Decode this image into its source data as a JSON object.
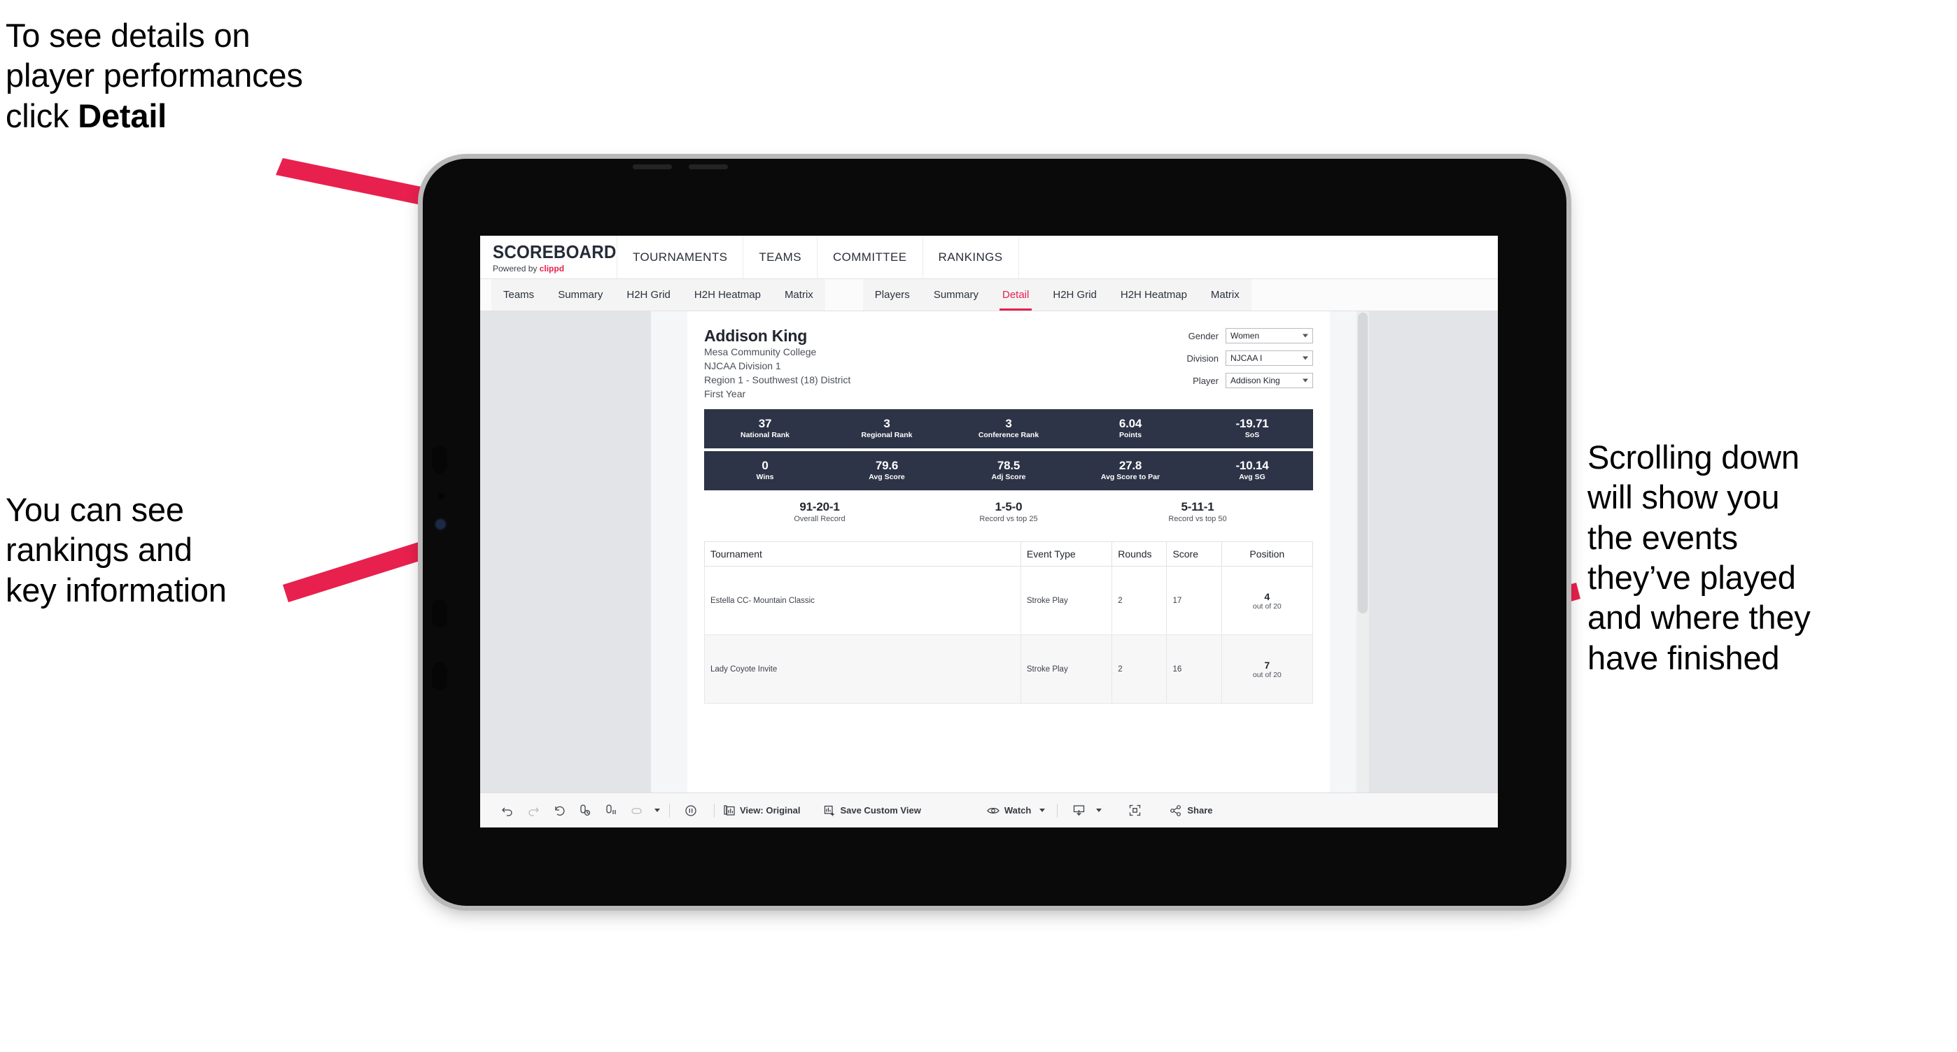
{
  "annotations": {
    "top_left": {
      "line1": "To see details on",
      "line2": "player performances",
      "line3_plain": "click ",
      "line3_bold": "Detail"
    },
    "mid_left": {
      "line1": "You can see",
      "line2": "rankings and",
      "line3": "key information"
    },
    "right": {
      "line1": "Scrolling down",
      "line2": "will show you",
      "line3": "the events",
      "line4": "they’ve played",
      "line5": "and where they",
      "line6": "have finished"
    },
    "arrow_color": "#E8204E"
  },
  "app": {
    "logo": {
      "word": "SCOREBOARD",
      "powered_prefix": "Powered by ",
      "brand": "clippd"
    },
    "top_nav": [
      {
        "label": "TOURNAMENTS"
      },
      {
        "label": "TEAMS"
      },
      {
        "label": "COMMITTEE"
      },
      {
        "label": "RANKINGS"
      }
    ],
    "sub_nav_teams": [
      {
        "label": "Teams",
        "active": false
      },
      {
        "label": "Summary",
        "active": false
      },
      {
        "label": "H2H Grid",
        "active": false
      },
      {
        "label": "H2H Heatmap",
        "active": false
      },
      {
        "label": "Matrix",
        "active": false
      }
    ],
    "sub_nav_players": [
      {
        "label": "Players",
        "active": false
      },
      {
        "label": "Summary",
        "active": false
      },
      {
        "label": "Detail",
        "active": true
      },
      {
        "label": "H2H Grid",
        "active": false
      },
      {
        "label": "H2H Heatmap",
        "active": false
      },
      {
        "label": "Matrix",
        "active": false
      }
    ],
    "accent_color": "#E8204E",
    "stat_bar_color": "#2E3447"
  },
  "player": {
    "name": "Addison King",
    "school": "Mesa Community College",
    "division": "NJCAA Division 1",
    "region": "Region 1 - Southwest (18) District",
    "year": "First Year"
  },
  "filters": [
    {
      "label": "Gender",
      "value": "Women"
    },
    {
      "label": "Division",
      "value": "NJCAA I"
    },
    {
      "label": "Player",
      "value": "Addison King"
    }
  ],
  "stats_row_1": [
    {
      "value": "37",
      "label": "National Rank"
    },
    {
      "value": "3",
      "label": "Regional Rank"
    },
    {
      "value": "3",
      "label": "Conference Rank"
    },
    {
      "value": "6.04",
      "label": "Points"
    },
    {
      "value": "-19.71",
      "label": "SoS"
    }
  ],
  "stats_row_2": [
    {
      "value": "0",
      "label": "Wins"
    },
    {
      "value": "79.6",
      "label": "Avg Score"
    },
    {
      "value": "78.5",
      "label": "Adj Score"
    },
    {
      "value": "27.8",
      "label": "Avg Score to Par"
    },
    {
      "value": "-10.14",
      "label": "Avg SG"
    }
  ],
  "records": [
    {
      "value": "91-20-1",
      "label": "Overall Record"
    },
    {
      "value": "1-5-0",
      "label": "Record vs top 25"
    },
    {
      "value": "5-11-1",
      "label": "Record vs top 50"
    }
  ],
  "events_table": {
    "headers": [
      "Tournament",
      "Event Type",
      "Rounds",
      "Score",
      "Position"
    ],
    "rows": [
      {
        "tournament": "Estella CC- Mountain Classic",
        "event_type": "Stroke Play",
        "rounds": "2",
        "score": "17",
        "position_num": "4",
        "position_of": "out of 20"
      },
      {
        "tournament": "Lady Coyote Invite",
        "event_type": "Stroke Play",
        "rounds": "2",
        "score": "16",
        "position_num": "7",
        "position_of": "out of 20"
      }
    ]
  },
  "toolbar": {
    "view_label": "View: Original",
    "save_label": "Save Custom View",
    "watch_label": "Watch",
    "share_label": "Share"
  }
}
